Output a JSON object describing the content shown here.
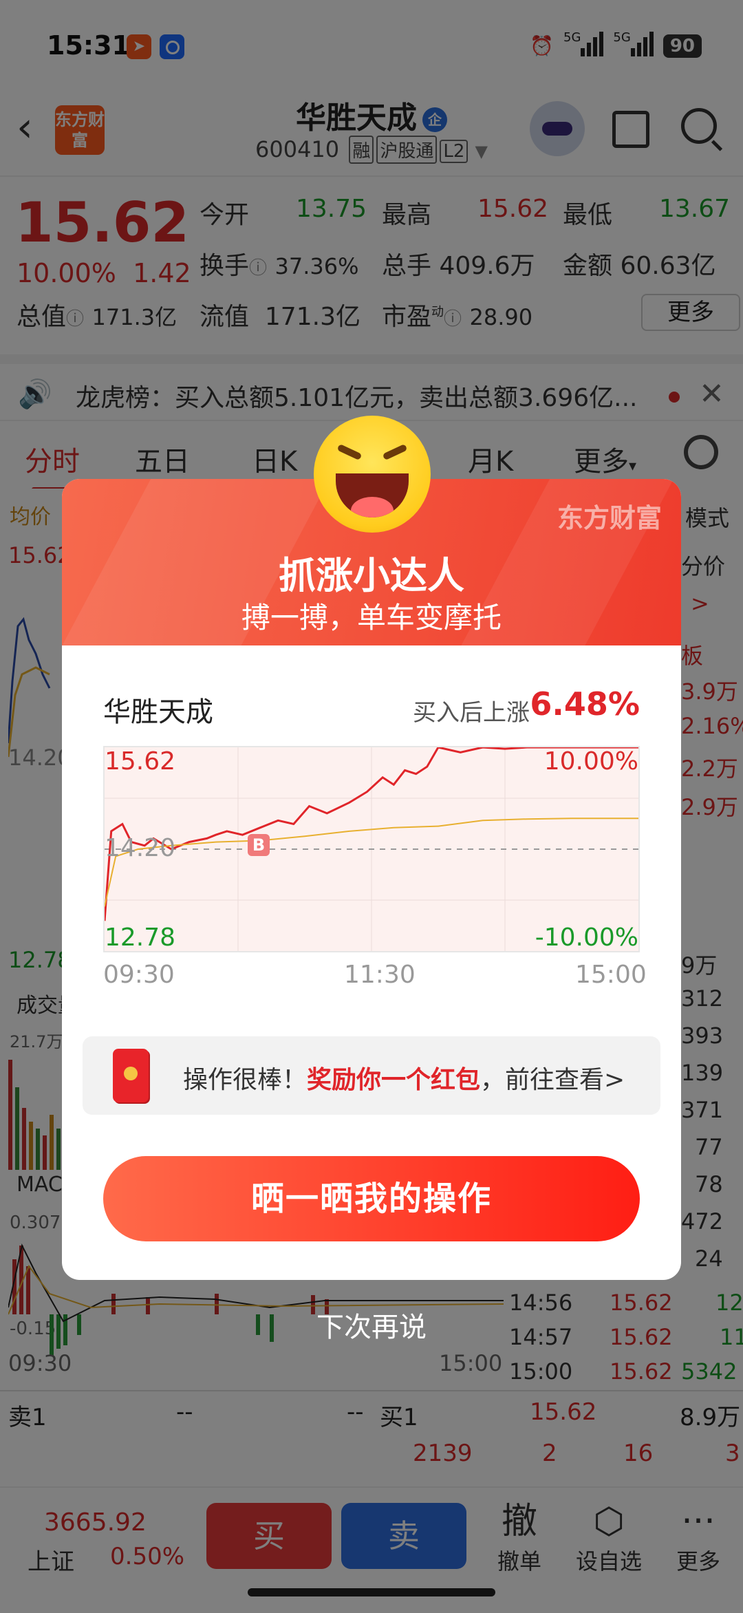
{
  "status_bar": {
    "time": "15:31",
    "network1": "5G",
    "network2": "5G",
    "battery": "90"
  },
  "header": {
    "logo_text": "东方财富",
    "stock_name": "华胜天成",
    "badge": "企",
    "code": "600410",
    "tags": [
      "融",
      "沪股通",
      "L2"
    ]
  },
  "quote": {
    "price": "15.62",
    "change_pct": "10.00%",
    "change_abs": "1.42",
    "open_label": "今开",
    "open": "13.75",
    "high_label": "最高",
    "high": "15.62",
    "low_label": "最低",
    "low": "13.67",
    "turnover_label": "换手",
    "turnover": "37.36%",
    "volume_label": "总手",
    "volume": "409.6万",
    "amount_label": "金额",
    "amount": "60.63亿",
    "mktcap_label": "总值",
    "mktcap": "171.3亿",
    "float_label": "流值",
    "float": "171.3亿",
    "pe_label": "市盈",
    "pe_sup": "动",
    "pe": "28.90",
    "more": "更多"
  },
  "notice": {
    "text": "龙虎榜：买入总额5.101亿元，卖出总额3.696亿..."
  },
  "tabs": [
    "分时",
    "五日",
    "日K",
    "月K",
    "更多"
  ],
  "background": {
    "avg_label": "均价",
    "price_top": "15.62",
    "price_mid": "14.20",
    "price_bottom": "12.78",
    "vol_label": "成交量",
    "vol_value": "21.7万",
    "macd_label": "MACD",
    "macd_top": "0.307",
    "macd_bottom": "-0.15",
    "time_start": "09:30",
    "time_end": "15:00",
    "right_mode": "模式",
    "right_price": "分价",
    "right_arrow": ">",
    "right_board": "板",
    "right_vals": [
      "3.9万",
      "2.16%",
      "2.2万",
      "2.9万"
    ],
    "ticks_vol": [
      "9万",
      "312",
      "393",
      "139",
      "371",
      "77",
      "78",
      "472",
      "24"
    ],
    "trades": [
      {
        "time": "14:56",
        "price": "15.62",
        "vol": "12"
      },
      {
        "time": "14:57",
        "price": "15.62",
        "vol": "11"
      },
      {
        "time": "15:00",
        "price": "15.62",
        "vol": "5342"
      }
    ],
    "sell1_label": "卖1",
    "sell1_price": "--",
    "sell1_vol": "--",
    "buy1_label": "买1",
    "buy1_price": "15.62",
    "buy1_vol": "8.9万",
    "row2": [
      "2139",
      "2",
      "16",
      "3"
    ]
  },
  "bottom": {
    "index_value": "3665.92",
    "index_name": "上证",
    "index_pct": "0.50%",
    "buy": "买",
    "sell": "卖",
    "cancel_glyph": "撤",
    "cancel": "撤单",
    "watch": "设自选",
    "more": "更多"
  },
  "popup": {
    "brand": "东方财富",
    "title": "抓涨小达人",
    "subtitle": "搏一搏，单车变摩托",
    "stock_name": "华胜天成",
    "gain_label": "买入后上涨",
    "gain_value": "6.48%",
    "chart_top_price": "15.62",
    "chart_top_pct": "10.00%",
    "chart_mid_price": "14.20",
    "chart_bottom_price": "12.78",
    "chart_bottom_pct": "-10.00%",
    "buy_marker": "B",
    "x_labels": [
      "09:30",
      "11:30",
      "15:00"
    ],
    "reward_prefix": "操作很棒！",
    "reward_highlight": "奖励你一个红包",
    "reward_suffix": "，前往查看>",
    "share_button": "晒一晒我的操作",
    "dismiss": "下次再说"
  },
  "chart_data": {
    "type": "line",
    "title": "",
    "xlabel": "",
    "ylabel": "",
    "x_ticks": [
      "09:30",
      "11:30",
      "15:00"
    ],
    "ylim": [
      12.78,
      15.62
    ],
    "series": [
      {
        "name": "",
        "color": "#e0252a",
        "x": [
          0,
          3,
          8,
          12,
          18,
          22,
          30,
          38,
          46,
          50,
          55,
          62,
          70,
          78,
          85,
          92,
          100,
          110,
          118,
          125,
          130,
          135,
          140,
          145,
          150,
          160,
          170,
          180,
          190,
          200,
          210,
          220,
          230,
          240
        ],
        "values": [
          13.2,
          14.45,
          14.55,
          14.3,
          14.25,
          14.35,
          14.2,
          14.3,
          14.35,
          14.4,
          14.45,
          14.4,
          14.5,
          14.6,
          14.55,
          14.8,
          14.7,
          14.85,
          15.0,
          15.2,
          15.1,
          15.3,
          15.25,
          15.35,
          15.62,
          15.55,
          15.62,
          15.6,
          15.62,
          15.62,
          15.62,
          15.62,
          15.62,
          15.62
        ]
      },
      {
        "name": "",
        "color": "#e8b030",
        "x": [
          0,
          5,
          15,
          30,
          50,
          70,
          90,
          110,
          130,
          150,
          170,
          190,
          210,
          240
        ],
        "values": [
          13.4,
          14.1,
          14.2,
          14.25,
          14.3,
          14.32,
          14.38,
          14.45,
          14.5,
          14.52,
          14.6,
          14.62,
          14.63,
          14.63
        ]
      }
    ]
  },
  "colors": {
    "up": "#d92a2a",
    "down": "#1a9a2a",
    "accent": "#e0252a",
    "buy": "#e83a3a",
    "sell": "#2f6fe0"
  }
}
